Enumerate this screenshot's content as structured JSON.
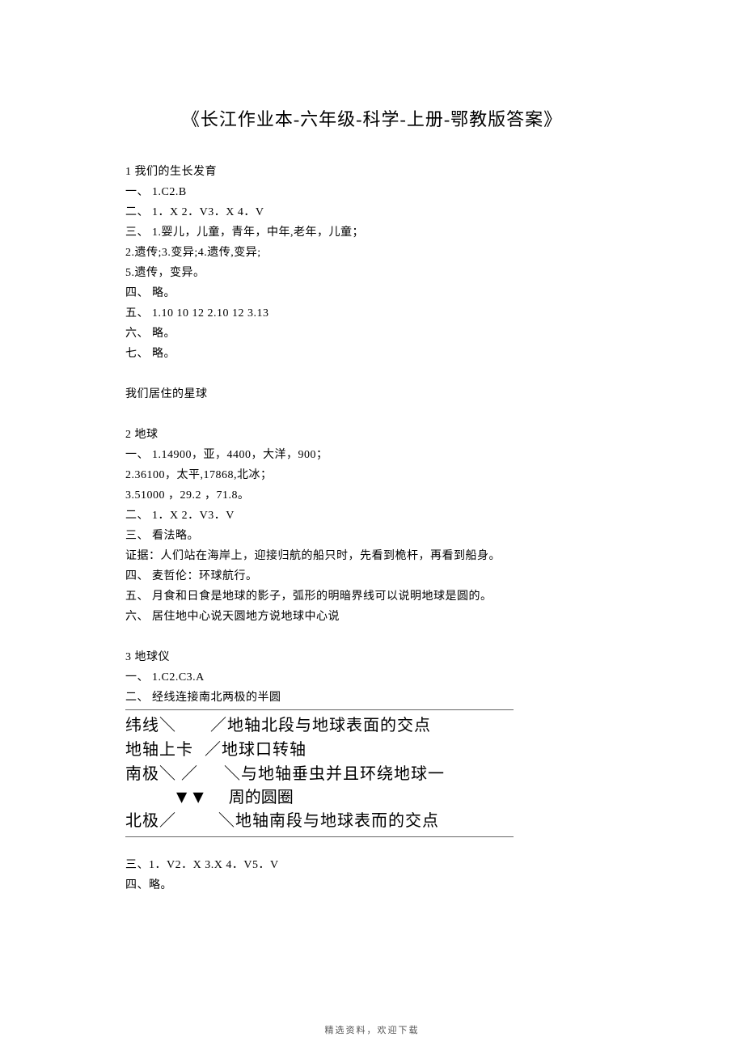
{
  "title": "《长江作业本-六年级-科学-上册-鄂教版答案》",
  "sec1": {
    "h": "1 我们的生长发育"
  },
  "s1": {
    "l1": "一、 1.C2.B",
    "l2": "二、 1．X 2．V3．X 4．V",
    "l3": "三、 1.婴儿，儿童，青年，中年,老年，儿童；",
    "l4": "2.遗传;3.变异;4.遗传,变异;",
    "l5": "5.遗传，变异。",
    "l6": "四、 略。",
    "l7": "五、 1.10 10 12 2.10 12 3.13",
    "l8": "六、 略。",
    "l9": "七、 略。"
  },
  "sec2": {
    "h": "我们居住的星球"
  },
  "sec3": {
    "h": "2 地球"
  },
  "s3": {
    "l1": "一、 1.14900，亚，4400，大洋，900；",
    "l2": "2.36100，太平,17868,北冰；",
    "l3": "3.51000 ，29.2 ，71.8。",
    "l4": "二、 1．X 2．V3．V",
    "l5": "三、 看法略。",
    "l6": "证据：人们站在海岸上，迎接归航的船只时，先看到桅杆，再看到船身。",
    "l7": "四、 麦哲伦：环球航行。",
    "l8": "五、 月食和日食是地球的影子，弧形的明暗界线可以说明地球是圆的。",
    "l9": "六、 居住地中心说天圆地方说地球中心说"
  },
  "sec4": {
    "h": "3 地球仪"
  },
  "s4": {
    "l1": "一、 1.C2.C3.A",
    "l2": "二、 经线连接南北两极的半圆"
  },
  "diagram": {
    "r1l": "纬线＼",
    "r1r": "／地轴北段与地球表面的交点",
    "r2l": "地轴上卡",
    "r2r": "／地球口转轴",
    "r3l": "南极＼ ／",
    "r3r": "＼与地轴垂虫并且环绕地球一",
    "r4c": "周的圆圈",
    "r5l": "北极／",
    "r5r": "＼地轴南段与地球表而的交点"
  },
  "s5": {
    "l1": "三、1．V2．X 3.X 4．V5．V",
    "l2": "四、略。"
  },
  "footer": "精选资料，欢迎下载"
}
